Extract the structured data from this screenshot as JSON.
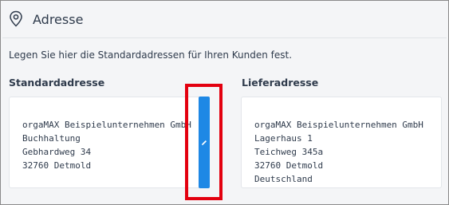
{
  "section": {
    "title": "Adresse",
    "icon": "location-pin-icon",
    "description": "Legen Sie hier die Standardadressen für Ihren Kunden fest."
  },
  "standard_address": {
    "heading": "Standardadresse",
    "lines": [
      "orgaMAX Beispielunternehmen GmbH",
      "Buchhaltung",
      "Gebhardweg 34",
      "32760 Detmold"
    ],
    "edit_icon": "pencil-icon"
  },
  "delivery_address": {
    "heading": "Lieferadresse",
    "lines": [
      "orgaMAX Beispielunternehmen GmbH",
      "Lagerhaus 1",
      "Teichweg 345a",
      "32760 Detmold",
      "Deutschland"
    ]
  },
  "colors": {
    "accent": "#1e88e5",
    "highlight": "#e3000f",
    "text": "#2f3b4c",
    "background": "#f4f5f7"
  }
}
